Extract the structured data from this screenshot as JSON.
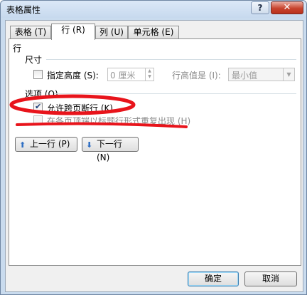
{
  "window": {
    "title": "表格属性",
    "help_glyph": "?",
    "close_glyph": "✕"
  },
  "tabs": [
    {
      "label": "表格 (T)",
      "active": false
    },
    {
      "label": "行 (R)",
      "active": true
    },
    {
      "label": "列 (U)",
      "active": false
    },
    {
      "label": "单元格 (E)",
      "active": false
    }
  ],
  "panel": {
    "section_title": "行",
    "size_group": "尺寸",
    "specify_height_label": "指定高度 (S):",
    "height_value": "0 厘米",
    "row_height_is_label": "行高值是 (I):",
    "row_height_mode": "最小值",
    "options_group": "选项 (O)",
    "allow_break_label": "允许跨页断行 (K)",
    "allow_break_checked": true,
    "repeat_header_label": "在各页顶端以标题行形式重复出现 (H)",
    "repeat_header_checked": false,
    "prev_row_label": "上一行 (P)",
    "next_row_label": "下一行 (N)"
  },
  "footer": {
    "ok_label": "确定",
    "cancel_label": "取消"
  },
  "colors": {
    "annotation": "#e8141b",
    "window_frame": "#c9dbee",
    "arrow_blue": "#2f6fc4"
  },
  "icons": {
    "prev_row": "up-arrow-icon",
    "next_row": "down-arrow-icon",
    "spin": "spinner-arrows-icon",
    "dropdown": "chevron-down-icon"
  }
}
